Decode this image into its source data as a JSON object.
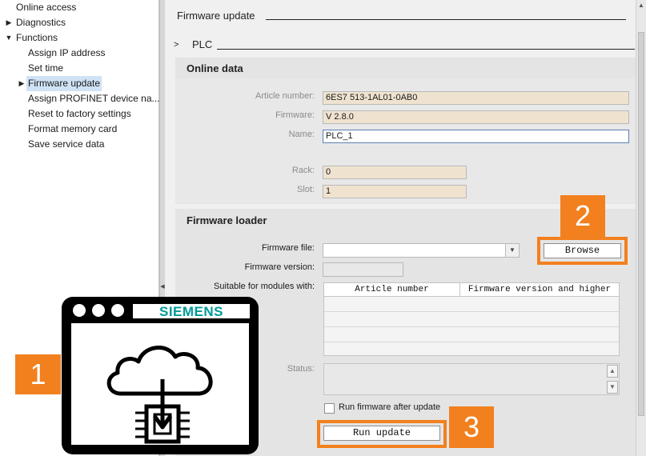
{
  "tree": {
    "items": [
      {
        "label": "Online access",
        "caret": ""
      },
      {
        "label": "Diagnostics",
        "caret": "▶"
      },
      {
        "label": "Functions",
        "caret": "▼"
      },
      {
        "label": "Assign IP address",
        "caret": ""
      },
      {
        "label": "Set time",
        "caret": ""
      },
      {
        "label": "Firmware update",
        "caret": "▶"
      },
      {
        "label": "Assign PROFINET device na...",
        "caret": ""
      },
      {
        "label": "Reset to factory settings",
        "caret": ""
      },
      {
        "label": "Format memory card",
        "caret": ""
      },
      {
        "label": "Save service data",
        "caret": ""
      }
    ]
  },
  "main": {
    "title": "Firmware update",
    "plc_caret": ">",
    "plc_title": "PLC"
  },
  "online_data": {
    "heading": "Online data",
    "article_label": "Article number:",
    "article_value": "6ES7 513-1AL01-0AB0",
    "firmware_label": "Firmware:",
    "firmware_value": "V 2.8.0",
    "name_label": "Name:",
    "name_value": "PLC_1",
    "rack_label": "Rack:",
    "rack_value": "0",
    "slot_label": "Slot:",
    "slot_value": "1"
  },
  "loader": {
    "heading": "Firmware loader",
    "file_label": "Firmware file:",
    "file_value": "",
    "version_label": "Firmware version:",
    "version_value": "",
    "suitable_label": "Suitable for modules with:",
    "columns": [
      "Article number",
      "Firmware version and higher"
    ],
    "status_label": "Status:",
    "browse_label": "Browse",
    "run_after_label": "Run firmware after update",
    "run_update_label": "Run update"
  },
  "callouts": [
    "1",
    "2",
    "3"
  ],
  "logo": {
    "brand": "SIEMENS"
  },
  "colors": {
    "accent_orange": "#f2801e",
    "brand_teal": "#009999",
    "field_tan": "#efe3d0"
  }
}
